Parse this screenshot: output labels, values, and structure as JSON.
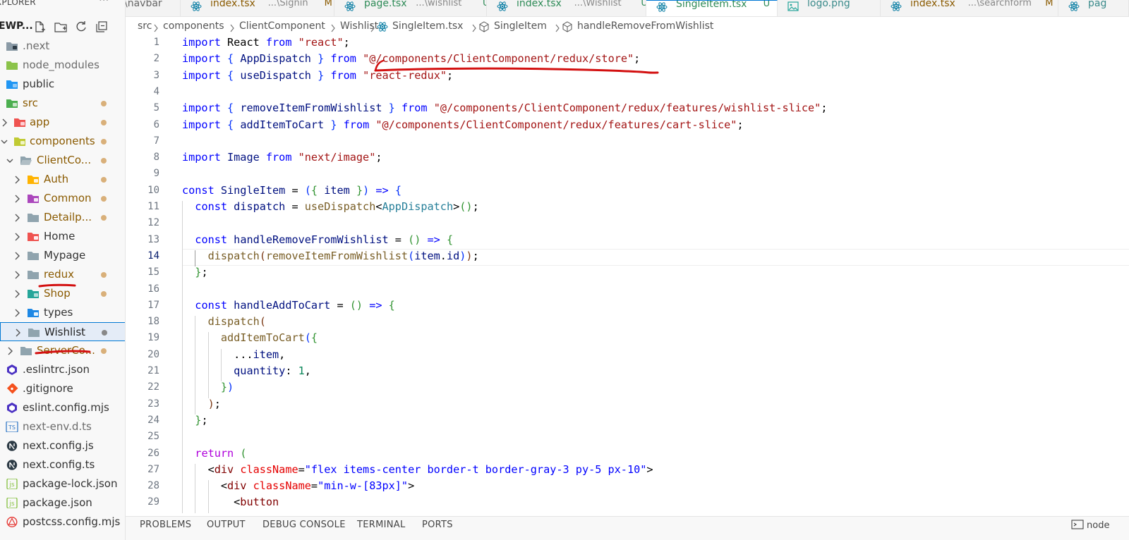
{
  "explorer": {
    "header": "XPLORER",
    "more": "···",
    "project_name": "EWP...",
    "items": [
      {
        "label": "next",
        "prefix": ".",
        "depth": 0,
        "icon": "next-folder-icon",
        "chev": "",
        "modified": false
      },
      {
        "label": "node_modules",
        "prefix": "",
        "depth": 0,
        "icon": "node-folder-icon",
        "chev": "",
        "modified": false
      },
      {
        "label": "public",
        "prefix": "",
        "depth": 0,
        "icon": "public-folder-icon",
        "chev": "",
        "modified": false
      },
      {
        "label": "src",
        "prefix": "",
        "depth": 0,
        "icon": "src-folder-icon",
        "chev": "",
        "modified": true
      },
      {
        "label": "app",
        "prefix": "",
        "depth": 1,
        "icon": "app-folder-icon",
        "chev": ">",
        "modified": true
      },
      {
        "label": "components",
        "prefix": "",
        "depth": 1,
        "icon": "components-folder-icon",
        "chev": "v",
        "modified": true
      },
      {
        "label": "ClientCo...",
        "prefix": "",
        "depth": 2,
        "icon": "folder-open-icon",
        "chev": "v",
        "modified": true
      },
      {
        "label": "Auth",
        "prefix": "",
        "depth": 3,
        "icon": "auth-folder-icon",
        "chev": ">",
        "modified": true
      },
      {
        "label": "Common",
        "prefix": "",
        "depth": 3,
        "icon": "common-folder-icon",
        "chev": ">",
        "modified": true
      },
      {
        "label": "Detailp...",
        "prefix": "",
        "depth": 3,
        "icon": "folder-icon",
        "chev": ">",
        "modified": true
      },
      {
        "label": "Home",
        "prefix": "",
        "depth": 3,
        "icon": "home-folder-icon",
        "chev": ">",
        "modified": false
      },
      {
        "label": "Mypage",
        "prefix": "",
        "depth": 3,
        "icon": "folder-icon",
        "chev": ">",
        "modified": false
      },
      {
        "label": "redux",
        "prefix": "",
        "depth": 3,
        "icon": "folder-icon",
        "chev": ">",
        "modified": true
      },
      {
        "label": "Shop",
        "prefix": "",
        "depth": 3,
        "icon": "shop-folder-icon",
        "chev": ">",
        "modified": true
      },
      {
        "label": "types",
        "prefix": "",
        "depth": 3,
        "icon": "types-folder-icon",
        "chev": ">",
        "modified": false
      },
      {
        "label": "Wishlist",
        "prefix": "",
        "depth": 3,
        "icon": "folder-icon",
        "chev": ">",
        "modified": true,
        "selected": true
      },
      {
        "label": "ServerCo...",
        "prefix": "",
        "depth": 2,
        "icon": "folder-icon",
        "chev": ">",
        "modified": true
      },
      {
        "label": ".eslintrc.json",
        "prefix": "",
        "depth": 0,
        "icon": "eslint-icon",
        "chev": "",
        "modified": false
      },
      {
        "label": ".gitignore",
        "prefix": "",
        "depth": 0,
        "icon": "git-icon",
        "chev": "",
        "modified": false
      },
      {
        "label": "eslint.config.mjs",
        "prefix": "",
        "depth": 0,
        "icon": "eslint-icon",
        "chev": "",
        "modified": false
      },
      {
        "label": "next-env.d.ts",
        "prefix": "",
        "depth": 0,
        "icon": "ts-file-icon",
        "chev": "",
        "modified": false
      },
      {
        "label": "next.config.js",
        "prefix": "",
        "depth": 0,
        "icon": "next-file-icon",
        "chev": "",
        "modified": false
      },
      {
        "label": "next.config.ts",
        "prefix": "",
        "depth": 0,
        "icon": "next-file-icon",
        "chev": "",
        "modified": false
      },
      {
        "label": "package-lock.json",
        "prefix": "",
        "depth": 0,
        "icon": "json-icon",
        "chev": "",
        "modified": false
      },
      {
        "label": "package.json",
        "prefix": "",
        "depth": 0,
        "icon": "json-icon",
        "chev": "",
        "modified": false
      },
      {
        "label": "postcss.config.mjs",
        "prefix": "",
        "depth": 0,
        "icon": "postcss-icon",
        "chev": "",
        "modified": false
      }
    ]
  },
  "tabs": [
    {
      "name": "\\navbar",
      "path": "",
      "status": "",
      "active": false,
      "icon": ""
    },
    {
      "name": "index.tsx",
      "path": "...\\Signin",
      "status": "M",
      "active": false,
      "icon": "react-icon"
    },
    {
      "name": "page.tsx",
      "path": "...\\wishlist",
      "status": "U",
      "active": false,
      "icon": "react-icon"
    },
    {
      "name": "index.tsx",
      "path": "...\\Wishlist",
      "status": "U",
      "active": false,
      "icon": "react-icon"
    },
    {
      "name": "SingleItem.tsx",
      "path": "",
      "status": "U",
      "active": true,
      "icon": "react-icon"
    },
    {
      "name": "logo.png",
      "path": "",
      "status": "",
      "active": false,
      "icon": "image-icon"
    },
    {
      "name": "index.tsx",
      "path": "...\\searchform",
      "status": "M",
      "active": false,
      "icon": "react-icon"
    },
    {
      "name": "pag",
      "path": "",
      "status": "",
      "active": false,
      "icon": "react-icon"
    }
  ],
  "breadcrumb": [
    "src",
    "components",
    "ClientComponent",
    "Wishlist",
    "SingleItem.tsx",
    "SingleItem",
    "handleRemoveFromWishlist"
  ],
  "editor": {
    "current_line": 14,
    "lines": [
      {
        "n": "1",
        "toks": [
          [
            "k",
            "import"
          ],
          [
            "p",
            " React "
          ],
          [
            "k",
            "from"
          ],
          [
            "p",
            " "
          ],
          [
            "s",
            "\"react\""
          ],
          [
            "p",
            ";"
          ]
        ]
      },
      {
        "n": "2",
        "toks": [
          [
            "k",
            "import"
          ],
          [
            "p",
            " "
          ],
          [
            "b1",
            "{"
          ],
          [
            "v",
            " AppDispatch "
          ],
          [
            "b1",
            "}"
          ],
          [
            "p",
            " "
          ],
          [
            "k",
            "from"
          ],
          [
            "p",
            " "
          ],
          [
            "s",
            "\"@/components/ClientComponent/redux/store\""
          ],
          [
            "p",
            ";"
          ]
        ]
      },
      {
        "n": "3",
        "toks": [
          [
            "k",
            "import"
          ],
          [
            "p",
            " "
          ],
          [
            "b1",
            "{"
          ],
          [
            "v",
            " useDispatch "
          ],
          [
            "b1",
            "}"
          ],
          [
            "p",
            " "
          ],
          [
            "k",
            "from"
          ],
          [
            "p",
            " "
          ],
          [
            "s",
            "\"react-redux\""
          ],
          [
            "p",
            ";"
          ]
        ]
      },
      {
        "n": "4",
        "toks": []
      },
      {
        "n": "5",
        "toks": [
          [
            "k",
            "import"
          ],
          [
            "p",
            " "
          ],
          [
            "b1",
            "{"
          ],
          [
            "v",
            " removeItemFromWishlist "
          ],
          [
            "b1",
            "}"
          ],
          [
            "p",
            " "
          ],
          [
            "k",
            "from"
          ],
          [
            "p",
            " "
          ],
          [
            "s",
            "\"@/components/ClientComponent/redux/features/wishlist-slice\""
          ],
          [
            "p",
            ";"
          ]
        ]
      },
      {
        "n": "6",
        "toks": [
          [
            "k",
            "import"
          ],
          [
            "p",
            " "
          ],
          [
            "b1",
            "{"
          ],
          [
            "v",
            " addItemToCart "
          ],
          [
            "b1",
            "}"
          ],
          [
            "p",
            " "
          ],
          [
            "k",
            "from"
          ],
          [
            "p",
            " "
          ],
          [
            "s",
            "\"@/components/ClientComponent/redux/features/cart-slice\""
          ],
          [
            "p",
            ";"
          ]
        ]
      },
      {
        "n": "7",
        "toks": []
      },
      {
        "n": "8",
        "toks": [
          [
            "k",
            "import"
          ],
          [
            "v",
            " Image "
          ],
          [
            "k",
            "from"
          ],
          [
            "p",
            " "
          ],
          [
            "s",
            "\"next/image\""
          ],
          [
            "p",
            ";"
          ]
        ]
      },
      {
        "n": "9",
        "toks": []
      },
      {
        "n": "10",
        "toks": [
          [
            "k",
            "const"
          ],
          [
            "p",
            " "
          ],
          [
            "v",
            "SingleItem"
          ],
          [
            "p",
            " = "
          ],
          [
            "b1",
            "("
          ],
          [
            "b2",
            "{"
          ],
          [
            "v",
            " item "
          ],
          [
            "b2",
            "}"
          ],
          [
            "b1",
            ")"
          ],
          [
            "p",
            " "
          ],
          [
            "k",
            "=>"
          ],
          [
            "p",
            " "
          ],
          [
            "b1",
            "{"
          ]
        ]
      },
      {
        "n": "11",
        "toks": [
          [
            "p",
            "  "
          ],
          [
            "k",
            "const"
          ],
          [
            "p",
            " "
          ],
          [
            "v",
            "dispatch"
          ],
          [
            "p",
            " = "
          ],
          [
            "f",
            "useDispatch"
          ],
          [
            "p",
            "<"
          ],
          [
            "t",
            "AppDispatch"
          ],
          [
            "p",
            ">"
          ],
          [
            "b2",
            "()"
          ],
          [
            "p",
            ";"
          ]
        ]
      },
      {
        "n": "12",
        "toks": []
      },
      {
        "n": "13",
        "toks": [
          [
            "p",
            "  "
          ],
          [
            "k",
            "const"
          ],
          [
            "p",
            " "
          ],
          [
            "v",
            "handleRemoveFromWishlist"
          ],
          [
            "p",
            " = "
          ],
          [
            "b2",
            "()"
          ],
          [
            "p",
            " "
          ],
          [
            "k",
            "=>"
          ],
          [
            "p",
            " "
          ],
          [
            "b2",
            "{"
          ]
        ]
      },
      {
        "n": "14",
        "toks": [
          [
            "p",
            "    "
          ],
          [
            "f",
            "dispatch"
          ],
          [
            "b3",
            "("
          ],
          [
            "f",
            "removeItemFromWishlist"
          ],
          [
            "b1",
            "("
          ],
          [
            "v",
            "item"
          ],
          [
            "p",
            "."
          ],
          [
            "v",
            "id"
          ],
          [
            "b1",
            ")"
          ],
          [
            "b3",
            ")"
          ],
          [
            "p",
            ";"
          ]
        ]
      },
      {
        "n": "15",
        "toks": [
          [
            "p",
            "  "
          ],
          [
            "b2",
            "}"
          ],
          [
            "p",
            ";"
          ]
        ]
      },
      {
        "n": "16",
        "toks": []
      },
      {
        "n": "17",
        "toks": [
          [
            "p",
            "  "
          ],
          [
            "k",
            "const"
          ],
          [
            "p",
            " "
          ],
          [
            "v",
            "handleAddToCart"
          ],
          [
            "p",
            " = "
          ],
          [
            "b2",
            "()"
          ],
          [
            "p",
            " "
          ],
          [
            "k",
            "=>"
          ],
          [
            "p",
            " "
          ],
          [
            "b2",
            "{"
          ]
        ]
      },
      {
        "n": "18",
        "toks": [
          [
            "p",
            "    "
          ],
          [
            "f",
            "dispatch"
          ],
          [
            "b3",
            "("
          ]
        ]
      },
      {
        "n": "19",
        "toks": [
          [
            "p",
            "      "
          ],
          [
            "f",
            "addItemToCart"
          ],
          [
            "b1",
            "("
          ],
          [
            "b2",
            "{"
          ]
        ]
      },
      {
        "n": "20",
        "toks": [
          [
            "p",
            "        ..."
          ],
          [
            "v",
            "item"
          ],
          [
            "p",
            ","
          ]
        ]
      },
      {
        "n": "21",
        "toks": [
          [
            "p",
            "        "
          ],
          [
            "v",
            "quantity"
          ],
          [
            "p",
            ": "
          ],
          [
            "n",
            "1"
          ],
          [
            "p",
            ","
          ]
        ]
      },
      {
        "n": "22",
        "toks": [
          [
            "p",
            "      "
          ],
          [
            "b2",
            "}"
          ],
          [
            "b1",
            ")"
          ]
        ]
      },
      {
        "n": "23",
        "toks": [
          [
            "p",
            "    "
          ],
          [
            "b3",
            ")"
          ],
          [
            "p",
            ";"
          ]
        ]
      },
      {
        "n": "24",
        "toks": [
          [
            "p",
            "  "
          ],
          [
            "b2",
            "}"
          ],
          [
            "p",
            ";"
          ]
        ]
      },
      {
        "n": "25",
        "toks": []
      },
      {
        "n": "26",
        "toks": [
          [
            "p",
            "  "
          ],
          [
            "c",
            "return"
          ],
          [
            "p",
            " "
          ],
          [
            "b2",
            "("
          ]
        ]
      },
      {
        "n": "27",
        "toks": [
          [
            "p",
            "    <"
          ],
          [
            "tag",
            "div"
          ],
          [
            "p",
            " "
          ],
          [
            "a",
            "className"
          ],
          [
            "p",
            "="
          ],
          [
            "k",
            "\"flex items-center border-t border-gray-3 py-5 px-10\""
          ],
          [
            "p",
            ">"
          ]
        ]
      },
      {
        "n": "28",
        "toks": [
          [
            "p",
            "      <"
          ],
          [
            "tag",
            "div"
          ],
          [
            "p",
            " "
          ],
          [
            "a",
            "className"
          ],
          [
            "p",
            "="
          ],
          [
            "k",
            "\"min-w-[83px]\""
          ],
          [
            "p",
            ">"
          ]
        ]
      },
      {
        "n": "29",
        "toks": [
          [
            "p",
            "        <"
          ],
          [
            "tag",
            "button"
          ]
        ]
      }
    ]
  },
  "panel": {
    "tabs": [
      "PROBLEMS",
      "OUTPUT",
      "DEBUG CONSOLE",
      "TERMINAL",
      "PORTS"
    ],
    "right": "node"
  }
}
